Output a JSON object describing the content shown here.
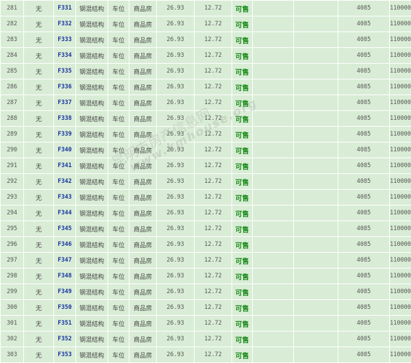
{
  "colors": {
    "row_background": "#d9edd6",
    "grid_line": "#ffffff",
    "room_link": "#1a34a0",
    "status_available": "#1c8c1c",
    "body_text": "#444444"
  },
  "watermark": {
    "site_name": "昆明市房产信息网",
    "site_url": "www.kmhouse.org"
  },
  "rows": [
    {
      "no": "281",
      "floor": "无",
      "room": "F331",
      "structure": "钢混结构",
      "usage": "车位",
      "type": "商品房",
      "building_area": "26.93",
      "unit_area": "12.72",
      "status": "可售",
      "price": "4085",
      "total": "110000"
    },
    {
      "no": "282",
      "floor": "无",
      "room": "F332",
      "structure": "钢混结构",
      "usage": "车位",
      "type": "商品房",
      "building_area": "26.93",
      "unit_area": "12.72",
      "status": "可售",
      "price": "4085",
      "total": "110000"
    },
    {
      "no": "283",
      "floor": "无",
      "room": "F333",
      "structure": "钢混结构",
      "usage": "车位",
      "type": "商品房",
      "building_area": "26.93",
      "unit_area": "12.72",
      "status": "可售",
      "price": "4085",
      "total": "110000"
    },
    {
      "no": "284",
      "floor": "无",
      "room": "F334",
      "structure": "钢混结构",
      "usage": "车位",
      "type": "商品房",
      "building_area": "26.93",
      "unit_area": "12.72",
      "status": "可售",
      "price": "4085",
      "total": "110000"
    },
    {
      "no": "285",
      "floor": "无",
      "room": "F335",
      "structure": "钢混结构",
      "usage": "车位",
      "type": "商品房",
      "building_area": "26.93",
      "unit_area": "12.72",
      "status": "可售",
      "price": "4085",
      "total": "110000"
    },
    {
      "no": "286",
      "floor": "无",
      "room": "F336",
      "structure": "钢混结构",
      "usage": "车位",
      "type": "商品房",
      "building_area": "26.93",
      "unit_area": "12.72",
      "status": "可售",
      "price": "4085",
      "total": "110000"
    },
    {
      "no": "287",
      "floor": "无",
      "room": "F337",
      "structure": "钢混结构",
      "usage": "车位",
      "type": "商品房",
      "building_area": "26.93",
      "unit_area": "12.72",
      "status": "可售",
      "price": "4085",
      "total": "110000"
    },
    {
      "no": "288",
      "floor": "无",
      "room": "F338",
      "structure": "钢混结构",
      "usage": "车位",
      "type": "商品房",
      "building_area": "26.93",
      "unit_area": "12.72",
      "status": "可售",
      "price": "4085",
      "total": "110000"
    },
    {
      "no": "289",
      "floor": "无",
      "room": "F339",
      "structure": "钢混结构",
      "usage": "车位",
      "type": "商品房",
      "building_area": "26.93",
      "unit_area": "12.72",
      "status": "可售",
      "price": "4085",
      "total": "110000"
    },
    {
      "no": "290",
      "floor": "无",
      "room": "F340",
      "structure": "钢混结构",
      "usage": "车位",
      "type": "商品房",
      "building_area": "26.93",
      "unit_area": "12.72",
      "status": "可售",
      "price": "4085",
      "total": "110000"
    },
    {
      "no": "291",
      "floor": "无",
      "room": "F341",
      "structure": "钢混结构",
      "usage": "车位",
      "type": "商品房",
      "building_area": "26.93",
      "unit_area": "12.72",
      "status": "可售",
      "price": "4085",
      "total": "110000"
    },
    {
      "no": "292",
      "floor": "无",
      "room": "F342",
      "structure": "钢混结构",
      "usage": "车位",
      "type": "商品房",
      "building_area": "26.93",
      "unit_area": "12.72",
      "status": "可售",
      "price": "4085",
      "total": "110000"
    },
    {
      "no": "293",
      "floor": "无",
      "room": "F343",
      "structure": "钢混结构",
      "usage": "车位",
      "type": "商品房",
      "building_area": "26.93",
      "unit_area": "12.72",
      "status": "可售",
      "price": "4085",
      "total": "110000"
    },
    {
      "no": "294",
      "floor": "无",
      "room": "F344",
      "structure": "钢混结构",
      "usage": "车位",
      "type": "商品房",
      "building_area": "26.93",
      "unit_area": "12.72",
      "status": "可售",
      "price": "4085",
      "total": "110000"
    },
    {
      "no": "295",
      "floor": "无",
      "room": "F345",
      "structure": "钢混结构",
      "usage": "车位",
      "type": "商品房",
      "building_area": "26.93",
      "unit_area": "12.72",
      "status": "可售",
      "price": "4085",
      "total": "110000"
    },
    {
      "no": "296",
      "floor": "无",
      "room": "F346",
      "structure": "钢混结构",
      "usage": "车位",
      "type": "商品房",
      "building_area": "26.93",
      "unit_area": "12.72",
      "status": "可售",
      "price": "4085",
      "total": "110000"
    },
    {
      "no": "297",
      "floor": "无",
      "room": "F347",
      "structure": "钢混结构",
      "usage": "车位",
      "type": "商品房",
      "building_area": "26.93",
      "unit_area": "12.72",
      "status": "可售",
      "price": "4085",
      "total": "110000"
    },
    {
      "no": "298",
      "floor": "无",
      "room": "F348",
      "structure": "钢混结构",
      "usage": "车位",
      "type": "商品房",
      "building_area": "26.93",
      "unit_area": "12.72",
      "status": "可售",
      "price": "4085",
      "total": "110000"
    },
    {
      "no": "299",
      "floor": "无",
      "room": "F349",
      "structure": "钢混结构",
      "usage": "车位",
      "type": "商品房",
      "building_area": "26.93",
      "unit_area": "12.72",
      "status": "可售",
      "price": "4085",
      "total": "110000"
    },
    {
      "no": "300",
      "floor": "无",
      "room": "F350",
      "structure": "钢混结构",
      "usage": "车位",
      "type": "商品房",
      "building_area": "26.93",
      "unit_area": "12.72",
      "status": "可售",
      "price": "4085",
      "total": "110000"
    },
    {
      "no": "301",
      "floor": "无",
      "room": "F351",
      "structure": "钢混结构",
      "usage": "车位",
      "type": "商品房",
      "building_area": "26.93",
      "unit_area": "12.72",
      "status": "可售",
      "price": "4085",
      "total": "110000"
    },
    {
      "no": "302",
      "floor": "无",
      "room": "F352",
      "structure": "钢混结构",
      "usage": "车位",
      "type": "商品房",
      "building_area": "26.93",
      "unit_area": "12.72",
      "status": "可售",
      "price": "4085",
      "total": "110000"
    },
    {
      "no": "303",
      "floor": "无",
      "room": "F353",
      "structure": "钢混结构",
      "usage": "车位",
      "type": "商品房",
      "building_area": "26.93",
      "unit_area": "12.72",
      "status": "可售",
      "price": "4085",
      "total": "110000"
    }
  ]
}
